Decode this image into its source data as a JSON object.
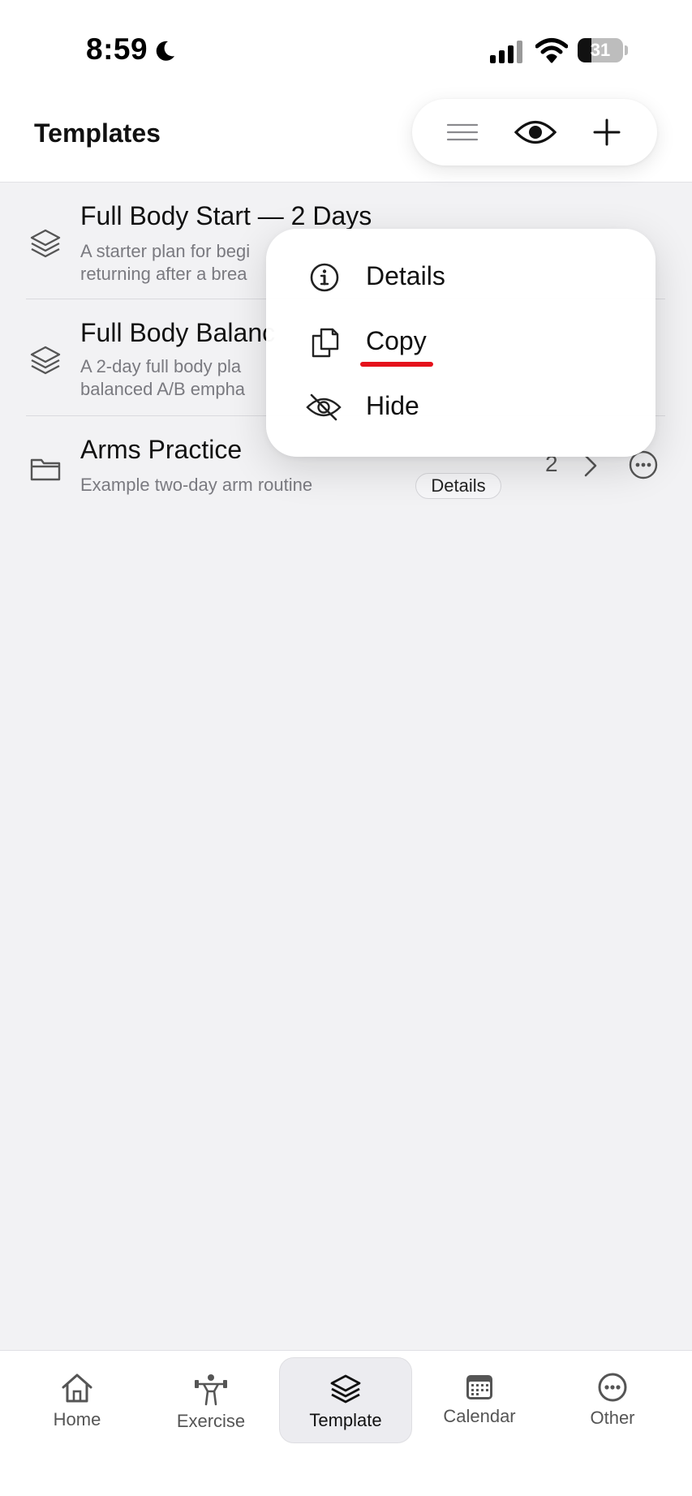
{
  "status_bar": {
    "time": "8:59",
    "battery_level": "31",
    "battery_fraction": 0.31
  },
  "header": {
    "title": "Templates"
  },
  "templates": [
    {
      "title": "Full Body Start — 2 Days",
      "subtitle_line1": "A starter plan for begi",
      "subtitle_line2": "returning after a brea",
      "icon": "layers-icon"
    },
    {
      "title": "Full Body Balanc",
      "subtitle_line1": "A 2-day full body pla",
      "subtitle_line2": "balanced A/B empha",
      "icon": "layers-icon"
    },
    {
      "title": "Arms Practice",
      "subtitle_line1": "Example two-day arm routine",
      "icon": "folder-icon",
      "badge": "Details",
      "count": "2"
    }
  ],
  "context_menu": {
    "items": [
      {
        "label": "Details",
        "icon": "info-icon"
      },
      {
        "label": "Copy",
        "icon": "copy-icon"
      },
      {
        "label": "Hide",
        "icon": "eye-slash-icon"
      }
    ]
  },
  "tabbar": {
    "items": [
      {
        "label": "Home",
        "icon": "home-icon"
      },
      {
        "label": "Exercise",
        "icon": "weightlifter-icon"
      },
      {
        "label": "Template",
        "icon": "layers-icon",
        "active": true
      },
      {
        "label": "Calendar",
        "icon": "calendar-icon"
      },
      {
        "label": "Other",
        "icon": "more-circle-icon"
      }
    ]
  },
  "colors": {
    "background": "#f2f2f4",
    "surface": "#ffffff",
    "accent_underline": "#e5121b",
    "text_primary": "#111111",
    "text_secondary": "#7a7a80"
  }
}
